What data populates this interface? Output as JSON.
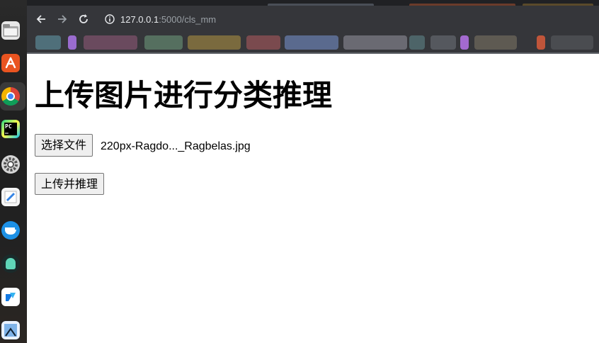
{
  "browser": {
    "url_host": "127.0.0.1",
    "url_path": ":5000/cls_mm",
    "accent_color": "#35363a"
  },
  "dock": {
    "icons": [
      "files-icon",
      "app-center-icon",
      "chrome-icon",
      "pycharm-icon",
      "settings-icon",
      "text-editor-icon",
      "docker-icon",
      "gitkraken-icon",
      "trae-icon",
      "image-viewer-icon"
    ]
  },
  "page": {
    "title": "上传图片进行分类推理",
    "choose_file_label": "选择文件",
    "file_name": "220px-Ragdo..._Ragbelas.jpg",
    "upload_button_label": "上传并推理"
  }
}
